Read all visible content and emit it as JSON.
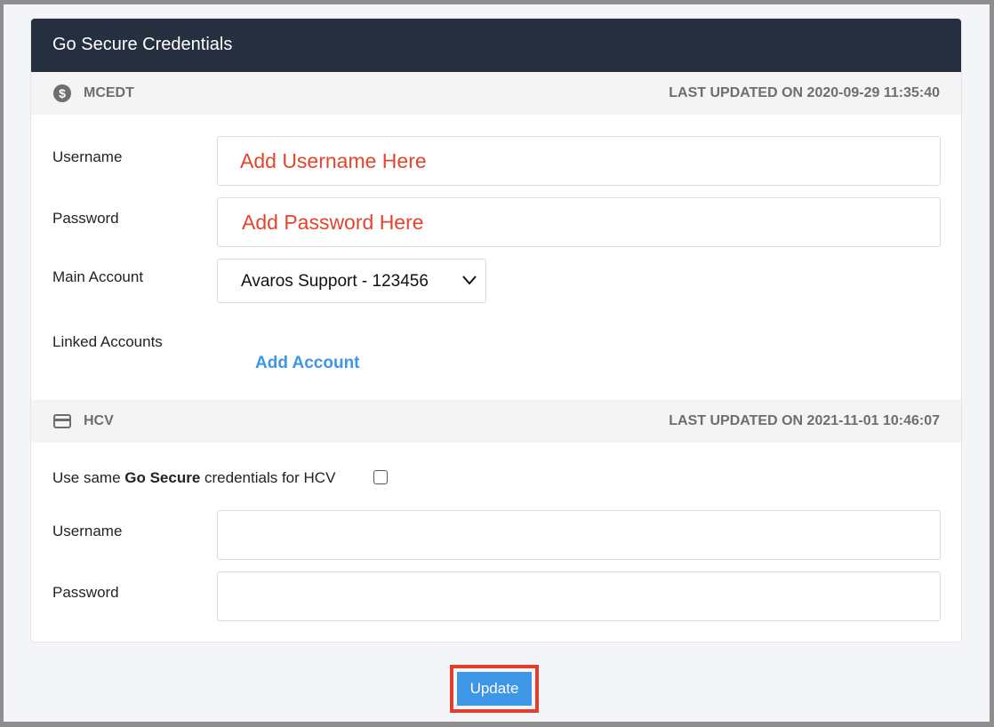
{
  "card": {
    "title": "Go Secure Credentials"
  },
  "mcedt": {
    "icon": "dollar-circle-icon",
    "name": "MCEDT",
    "last_updated": "LAST UPDATED ON 2020-09-29 11:35:40",
    "username_label": "Username",
    "username_hint": "Add Username Here",
    "password_label": "Password",
    "password_hint": "Add Password Here",
    "main_account_label": "Main Account",
    "main_account_value": "Avaros Support - 123456",
    "linked_accounts_label": "Linked Accounts",
    "add_account_label": "Add Account"
  },
  "hcv": {
    "icon": "credit-card-icon",
    "name": "HCV",
    "last_updated": "LAST UPDATED ON 2021-11-01 10:46:07",
    "same_credentials_prefix": "Use same ",
    "same_credentials_bold": "Go Secure",
    "same_credentials_suffix": " credentials for HCV",
    "same_credentials_checked": false,
    "username_label": "Username",
    "password_label": "Password"
  },
  "footer": {
    "update_label": "Update"
  },
  "colors": {
    "header_bg": "#262f40",
    "accent_blue": "#3d97e6",
    "annotation_red": "#e5442b"
  }
}
